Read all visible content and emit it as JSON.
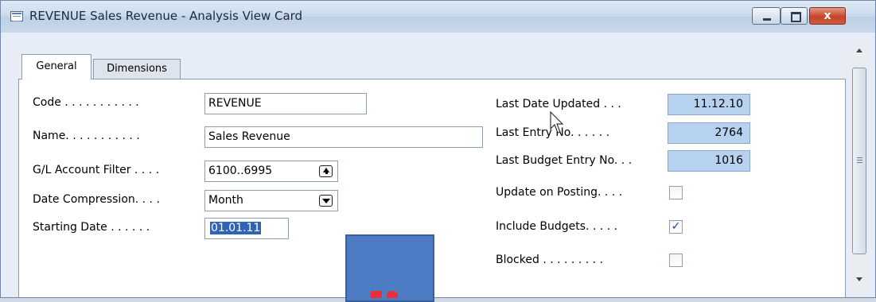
{
  "window": {
    "title": "REVENUE Sales Revenue - Analysis View Card",
    "controls": {
      "minimize": "minimize",
      "maximize": "maximize",
      "close": "x"
    }
  },
  "tabs": [
    {
      "label": "General",
      "active": true
    },
    {
      "label": "Dimensions",
      "active": false
    }
  ],
  "left_fields": {
    "code": {
      "label": "Code . . . . . . . . . . .",
      "value": "REVENUE"
    },
    "name": {
      "label": "Name. . . . . . . . . . .",
      "value": "Sales Revenue"
    },
    "gl_filter": {
      "label": "G/L Account Filter . . . .",
      "value": "6100..6995",
      "button": "assist-up-icon"
    },
    "date_compression": {
      "label": "Date Compression. . . .",
      "value": "Month",
      "button": "dropdown-icon"
    },
    "starting_date": {
      "label": "Starting Date . . . . . .",
      "value": "01.01.11"
    }
  },
  "right_fields": {
    "last_date_updated": {
      "label": "Last Date Updated . . .",
      "value": "11.12.10"
    },
    "last_entry_no": {
      "label": "Last Entry No. . . . . .",
      "value": "2764"
    },
    "last_budget_entry_no": {
      "label": "Last Budget Entry No. . .",
      "value": "1016"
    },
    "update_on_posting": {
      "label": "Update on Posting. . . .",
      "checked": false
    },
    "include_budgets": {
      "label": "Include Budgets. . . . .",
      "checked": true,
      "mark": "✓"
    },
    "blocked": {
      "label": "Blocked . . . . . . . . .",
      "checked": false
    }
  },
  "colors": {
    "readonly_field": "#b7d2ee",
    "selection": "#2e63b8",
    "overlay_box": "#4d7cc4",
    "close_button": "#c4442a"
  }
}
